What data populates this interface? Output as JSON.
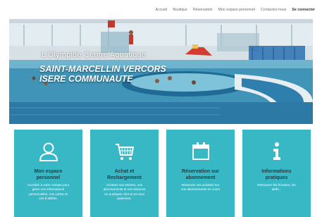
{
  "nav": {
    "items": [
      "Accueil",
      "Boutique",
      "Réservation",
      "Mon espace personnel",
      "Contactez-nous"
    ],
    "login": "Se connecter"
  },
  "hero": {
    "subtitle": "L'Olympide Centre Aquatique",
    "title_line1": "SAINT-MARCELLIN VERCORS",
    "title_line2": "ISERE COMMUNAUTE"
  },
  "cards": [
    {
      "icon": "user-icon",
      "title_line1": "Mon espace",
      "title_line2": "personnel",
      "desc_line1": "Accédez à votre compte pour",
      "desc_line2": "gérer vos informations",
      "desc_line3": "personnelles, vos cartes et",
      "desc_line4": "vos E-Billets."
    },
    {
      "icon": "shopping-cart-icon",
      "title_line1": "Achat et",
      "title_line2": "Rechargement",
      "desc_line1": "Achetez vos entrées, vos",
      "desc_line2": "abonnements et vos séances",
      "desc_line3": "en quelques clics et en seul",
      "desc_line4": "paiement."
    },
    {
      "icon": "calendar-icon",
      "title_line1": "Réservation sur",
      "title_line2": "abonnement",
      "desc_line1": "Réservez vos activités sur",
      "desc_line2": "vos abonnements en cours",
      "desc_line3": "",
      "desc_line4": ""
    },
    {
      "icon": "info-icon",
      "title_line1": "Informations",
      "title_line2": "pratiques",
      "desc_line1": "Retrouvez les horaires, les",
      "desc_line2": "tarifs...",
      "desc_line3": "",
      "desc_line4": ""
    }
  ],
  "colors": {
    "card_bg": "#38b7c4",
    "card_title": "#1f3d45"
  }
}
